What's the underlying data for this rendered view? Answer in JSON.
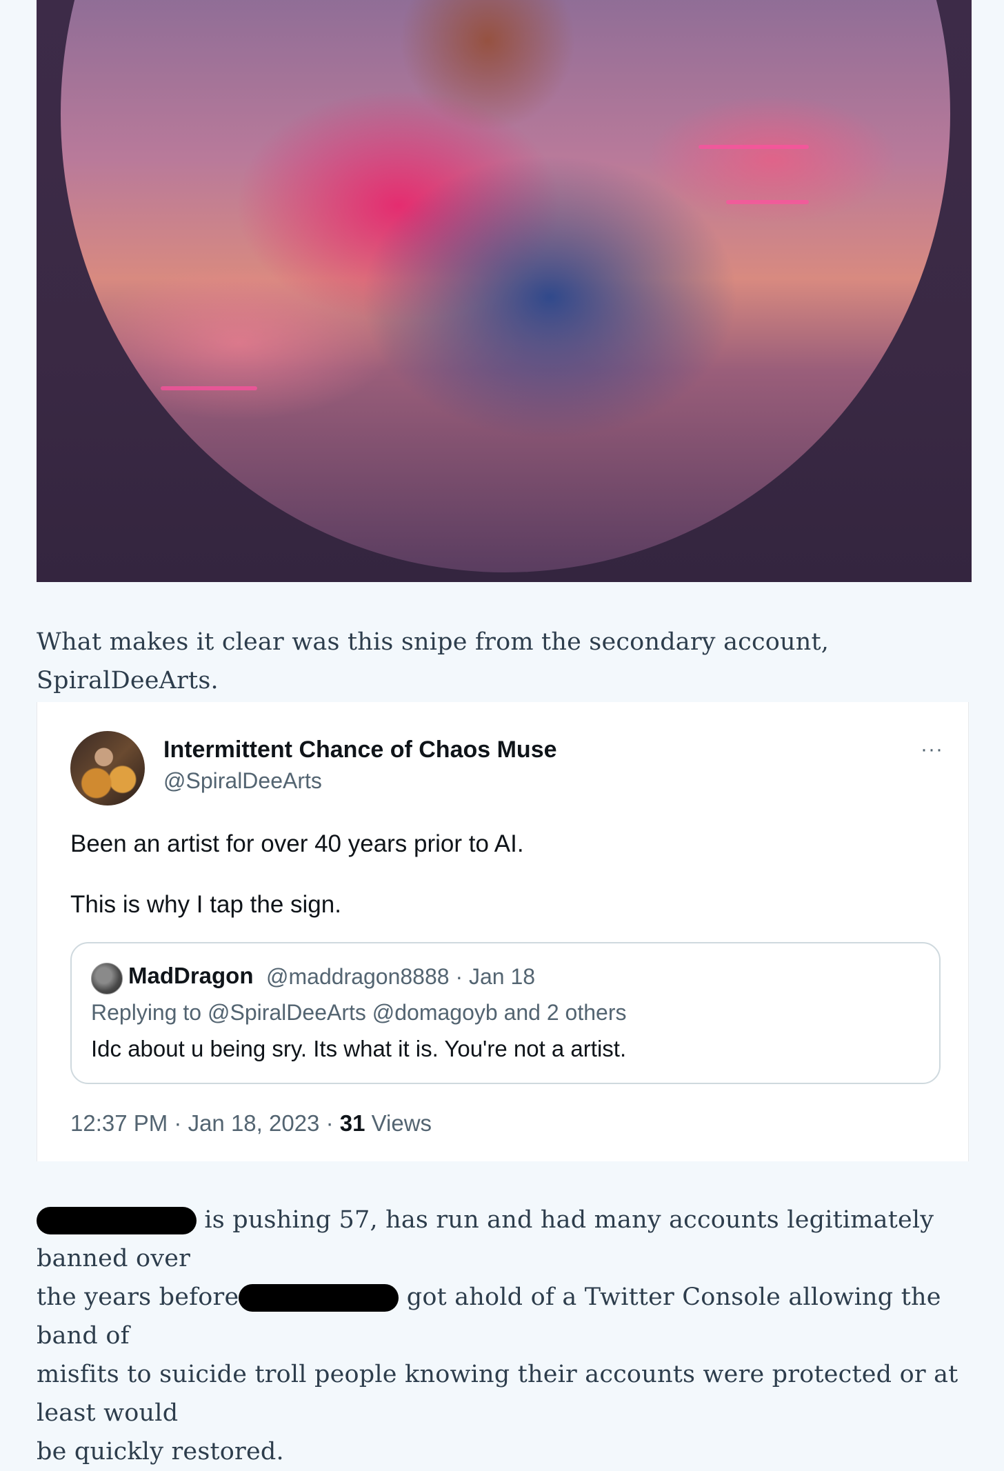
{
  "article": {
    "caption_para": "What makes it clear was this snipe from the secondary account, SpiralDeeArts.",
    "para2": {
      "line1_text": "is pushing 57, has run and had many accounts legitimately banned over",
      "line2_before": "the years before",
      "line2_after": "got ahold of a Twitter Console allowing the band of",
      "line3": "misfits to suicide troll people knowing their accounts were protected or at least would",
      "line4": "be quickly restored."
    }
  },
  "tweet": {
    "display_name": "Intermittent Chance of Chaos Muse",
    "handle": "@SpiralDeeArts",
    "more_icon": "···",
    "body_line1": "Been an artist for over 40 years prior to AI.",
    "body_line2": "This is why I tap the sign.",
    "quoted": {
      "display_name": "MadDragon",
      "meta": "@maddragon8888 · Jan 18",
      "replying_to": "Replying to @SpiralDeeArts @domagoyb and 2 others",
      "text": "Idc about u being sry. Its what it is. You're not a artist."
    },
    "timestamp": "12:37 PM · Jan 18, 2023 · ",
    "views_count": "31",
    "views_label": " Views"
  }
}
